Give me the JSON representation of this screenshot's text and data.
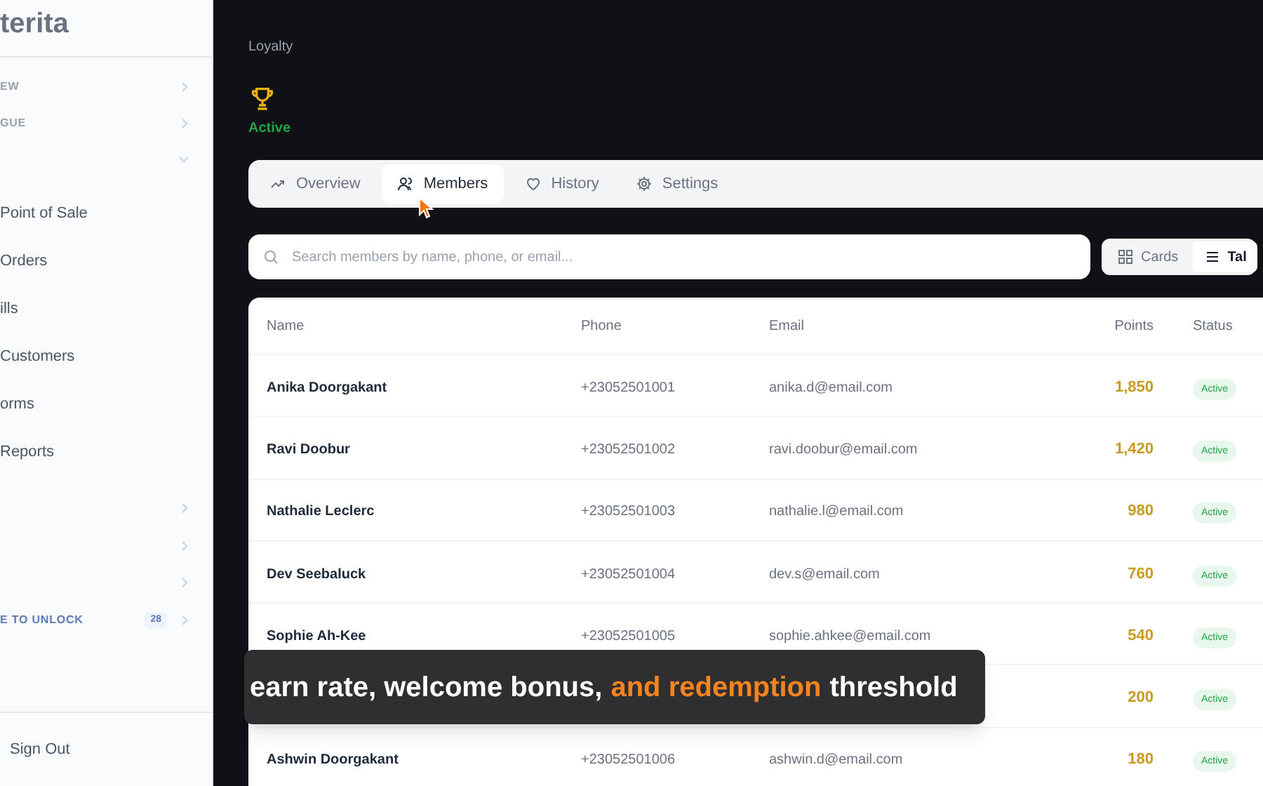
{
  "sidebar": {
    "logo": "terita",
    "sections": [
      {
        "label": "EW",
        "expanded": false
      },
      {
        "label": "GUE",
        "expanded": false
      },
      {
        "expanded": true
      }
    ],
    "items": [
      {
        "label": "Point of Sale"
      },
      {
        "label": "Orders"
      },
      {
        "label": "ills"
      },
      {
        "label": "Customers"
      },
      {
        "label": "orms"
      },
      {
        "label": "Reports"
      }
    ],
    "lower_sections": [
      {
        "expanded": false
      },
      {
        "expanded": false
      },
      {
        "expanded": false
      },
      {
        "label": "E TO UNLOCK",
        "badge": "28",
        "expanded": false
      }
    ],
    "sign_out": "Sign Out"
  },
  "breadcrumb": "Loyalty",
  "program": {
    "status": "Active"
  },
  "tabs": [
    {
      "label": "Overview",
      "selected": false
    },
    {
      "label": "Members",
      "selected": true
    },
    {
      "label": "History",
      "selected": false
    },
    {
      "label": "Settings",
      "selected": false
    }
  ],
  "search": {
    "placeholder": "Search members by name, phone, or email..."
  },
  "view_toggle": [
    {
      "label": "Cards",
      "selected": false
    },
    {
      "label": "Tal",
      "selected": true
    }
  ],
  "table": {
    "columns": [
      "Name",
      "Phone",
      "Email",
      "Points",
      "Status"
    ],
    "rows": [
      {
        "name": "Anika Doorgakant",
        "phone": "+23052501001",
        "email": "anika.d@email.com",
        "points": "1,850",
        "status": "Active"
      },
      {
        "name": "Ravi Doobur",
        "phone": "+23052501002",
        "email": "ravi.doobur@email.com",
        "points": "1,420",
        "status": "Active"
      },
      {
        "name": "Nathalie Leclerc",
        "phone": "+23052501003",
        "email": "nathalie.l@email.com",
        "points": "980",
        "status": "Active"
      },
      {
        "name": "Dev Seebaluck",
        "phone": "+23052501004",
        "email": "dev.s@email.com",
        "points": "760",
        "status": "Active"
      },
      {
        "name": "Sophie Ah-Kee",
        "phone": "+23052501005",
        "email": "sophie.ahkee@email.com",
        "points": "540",
        "status": "Active"
      },
      {
        "points": "200",
        "status": "Active"
      },
      {
        "name": "Ashwin Doorgakant",
        "phone": "+23052501006",
        "email": "ashwin.d@email.com",
        "points": "180",
        "status": "Active"
      }
    ]
  },
  "caption": [
    {
      "text": "earn rate, welcome bonus,",
      "highlight": false
    },
    {
      "text": "and redemption",
      "highlight": true
    },
    {
      "text": "threshold",
      "highlight": false
    }
  ]
}
